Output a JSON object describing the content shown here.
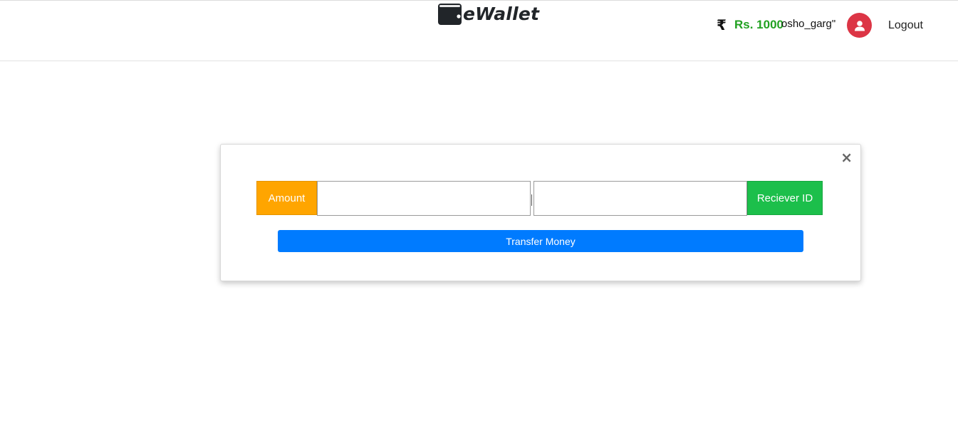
{
  "header": {
    "brand_name": "eWallet",
    "balance": "Rs. 1000",
    "username": "osho_garg\"",
    "logout_label": "Logout",
    "currency_icon": "rupee-icon",
    "brand_icon": "wallet-icon",
    "avatar_icon": "user-icon"
  },
  "transfer_modal": {
    "close_glyph": "×",
    "amount_label": "Amount",
    "amount_value": "",
    "receiver_label": "Reciever ID",
    "receiver_value": "",
    "submit_label": "Transfer Money"
  },
  "colors": {
    "balance": "#21a121",
    "avatar": "#dc3545",
    "amount_label_bg": "#ffa500",
    "receiver_label_bg": "#1cbf4b",
    "submit_bg": "#007bff"
  }
}
